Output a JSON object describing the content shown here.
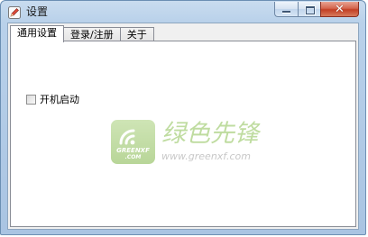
{
  "window": {
    "title": "设置",
    "close_glyph": "✕"
  },
  "tabs": [
    {
      "label": "通用设置",
      "active": true
    },
    {
      "label": "登录/注册",
      "active": false
    },
    {
      "label": "关于",
      "active": false
    }
  ],
  "general": {
    "autostart_label": "开机启动",
    "autostart_checked": false
  },
  "watermark": {
    "logo_line1": "GREENXF",
    "logo_line2": ".COM",
    "brand_cn": "绿色先锋",
    "url": "www.greenxf.com"
  },
  "icons": {
    "app": "pencil-icon",
    "minimize": "minimize-icon",
    "maximize": "maximize-icon",
    "close": "close-icon",
    "watermark_logo": "greenxf-logo-icon"
  },
  "colors": {
    "titlebar": "#b9d1ea",
    "close_button": "#c74b30",
    "watermark_green": "#8cc154"
  }
}
